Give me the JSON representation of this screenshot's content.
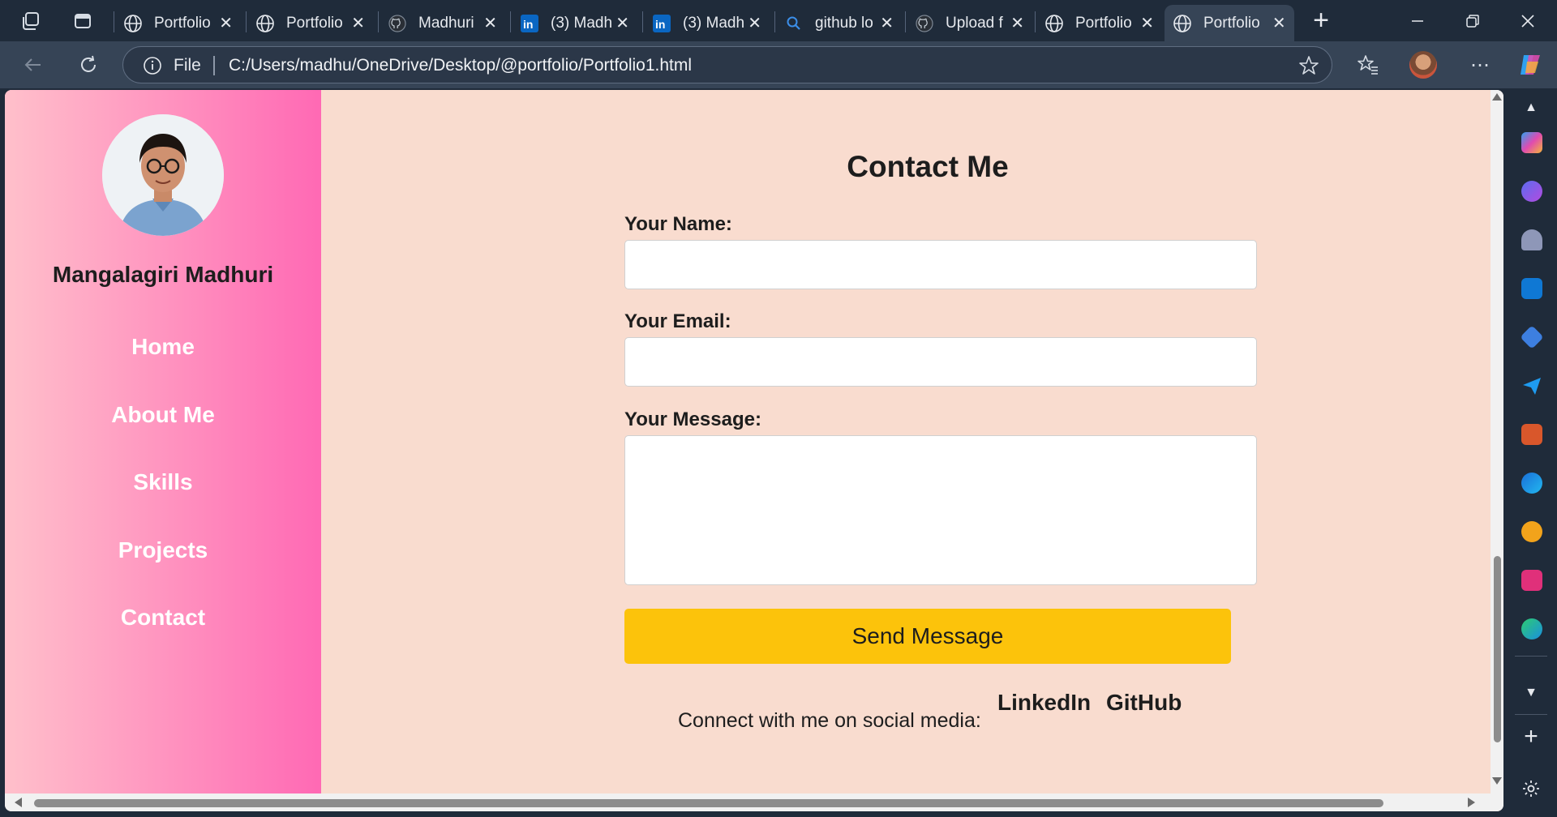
{
  "browser": {
    "tabs": [
      {
        "label": "Portfolio",
        "icon": "globe-icon",
        "active": false
      },
      {
        "label": "Portfolio",
        "icon": "globe-icon",
        "active": false
      },
      {
        "label": "Madhuri",
        "icon": "github-icon",
        "active": false
      },
      {
        "label": "(3) Madh",
        "icon": "linkedin-icon",
        "active": false
      },
      {
        "label": "(3) Madh",
        "icon": "linkedin-icon",
        "active": false
      },
      {
        "label": "github lo",
        "icon": "search-icon",
        "active": false
      },
      {
        "label": "Upload f",
        "icon": "github-icon",
        "active": false
      },
      {
        "label": "Portfolio",
        "icon": "globe-icon",
        "active": false
      },
      {
        "label": "Portfolio",
        "icon": "globe-icon",
        "active": true
      }
    ],
    "address": {
      "scheme_label": "File",
      "url": "C:/Users/madhu/OneDrive/Desktop/@portfolio/Portfolio1.html"
    },
    "colors": {
      "chrome_dark": "#1f2b3a",
      "chrome_light": "#364456",
      "linkedin": "#0a66c2"
    }
  },
  "sidebar": {
    "name": "Mangalagiri Madhuri",
    "nav": [
      "Home",
      "About Me",
      "Skills",
      "Projects",
      "Contact"
    ],
    "gradient": [
      "#ffc0cb",
      "#ff69b4"
    ]
  },
  "contact": {
    "title": "Contact Me",
    "name_label": "Your Name:",
    "email_label": "Your Email:",
    "message_label": "Your Message:",
    "send_label": "Send Message",
    "social_text": "Connect with me on social media:",
    "social_links": [
      "LinkedIn",
      "GitHub"
    ],
    "colors": {
      "page_bg": "#f9dccf",
      "button": "#fcc30b"
    }
  }
}
